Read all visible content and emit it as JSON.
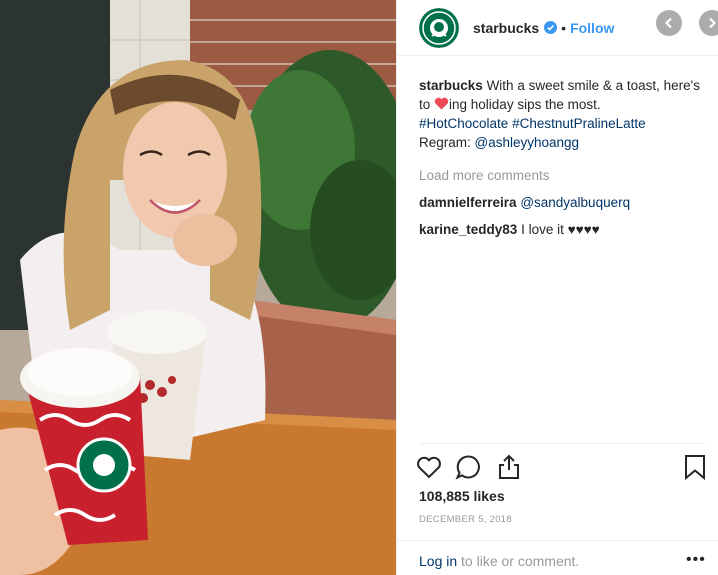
{
  "header": {
    "username": "starbucks",
    "follow_label": "Follow",
    "separator": "•"
  },
  "caption": {
    "username": "starbucks",
    "text_before_heart": "With a sweet smile & a toast, here's to ",
    "text_after_heart": "ing holiday sips the most.",
    "hashtags": [
      "#HotChocolate",
      "#ChestnutPralineLatte"
    ],
    "regram_label": "Regram:",
    "regram_handle": "@ashleyyhoangg"
  },
  "load_more_label": "Load more comments",
  "comments": [
    {
      "username": "damnielferreira",
      "text": "@sandyalbuquerq"
    },
    {
      "username": "karine_teddy83",
      "text": "I love it",
      "hearts": "♥♥♥♥"
    }
  ],
  "likes": "108,885 likes",
  "date": "DECEMBER 5, 2018",
  "footer": {
    "login_label": "Log in",
    "rest": "to like or comment.",
    "more_label": "•••"
  },
  "icons": {
    "like": "heart-outline-icon",
    "comment": "speech-bubble-icon",
    "share": "share-upload-icon",
    "save": "bookmark-icon",
    "verified": "verified-badge-icon"
  },
  "colors": {
    "link_blue": "#3897f0",
    "hashtag_blue": "#003569",
    "muted_gray": "#999999",
    "starbucks_green": "#00704a",
    "heart_red": "#ed4956"
  }
}
